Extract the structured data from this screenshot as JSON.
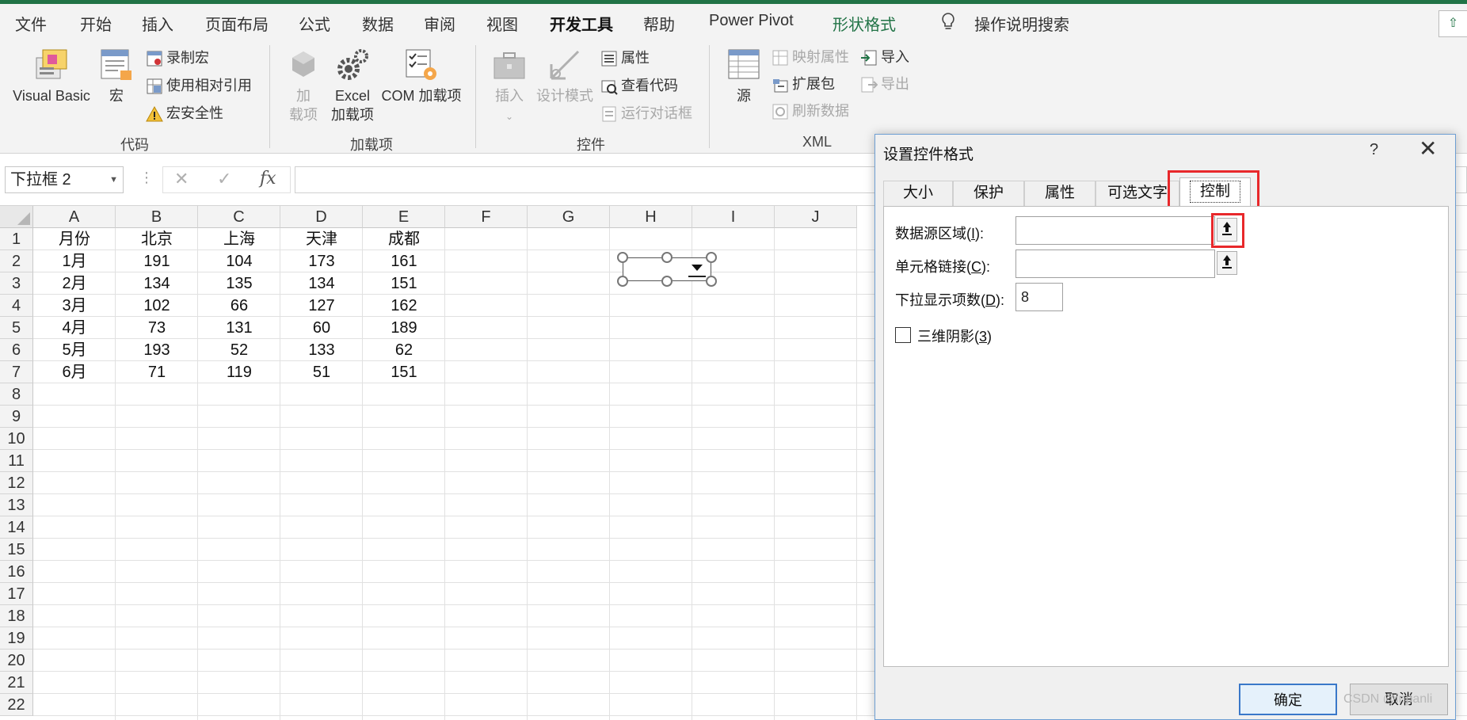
{
  "ribbon_tabs": [
    "文件",
    "开始",
    "插入",
    "页面布局",
    "公式",
    "数据",
    "审阅",
    "视图",
    "开发工具",
    "帮助",
    "Power Pivot",
    "形状格式"
  ],
  "active_tab": "开发工具",
  "search_label": "操作说明搜索",
  "groups": {
    "code": {
      "label": "代码",
      "visual_basic": "Visual Basic",
      "macros": "宏",
      "record_macro": "录制宏",
      "relative_ref": "使用相对引用",
      "macro_security": "宏安全性"
    },
    "addins": {
      "label": "加载项",
      "addins_l1": "加",
      "addins_l2": "载项",
      "excel_addins_l1": "Excel",
      "excel_addins_l2": "加载项",
      "com_addins": "COM 加载项"
    },
    "controls": {
      "label": "控件",
      "insert": "插入",
      "design_mode": "设计模式",
      "properties": "属性",
      "view_code": "查看代码",
      "run_dialog": "运行对话框"
    },
    "xml": {
      "label": "XML",
      "source": "源",
      "map_properties": "映射属性",
      "expansion_packs": "扩展包",
      "refresh_data": "刷新数据",
      "import": "导入",
      "export": "导出"
    }
  },
  "name_box": "下拉框 2",
  "formula_icons": {
    "cancel": "✕",
    "enter": "✓",
    "fx": "fx"
  },
  "columns": [
    "A",
    "B",
    "C",
    "D",
    "E",
    "F",
    "G",
    "H",
    "I",
    "J"
  ],
  "rows": [
    "1",
    "2",
    "3",
    "4",
    "5",
    "6",
    "7",
    "8",
    "9",
    "10",
    "11",
    "12",
    "13",
    "14",
    "15",
    "16",
    "17",
    "18",
    "19",
    "20",
    "21",
    "22"
  ],
  "table": {
    "header": [
      "月份",
      "北京",
      "上海",
      "天津",
      "成都"
    ],
    "rows": [
      [
        "1月",
        "191",
        "104",
        "173",
        "161"
      ],
      [
        "2月",
        "134",
        "135",
        "134",
        "151"
      ],
      [
        "3月",
        "102",
        "66",
        "127",
        "162"
      ],
      [
        "4月",
        "73",
        "131",
        "60",
        "189"
      ],
      [
        "5月",
        "193",
        "52",
        "133",
        "62"
      ],
      [
        "6月",
        "71",
        "119",
        "51",
        "151"
      ]
    ]
  },
  "dialog": {
    "title": "设置控件格式",
    "help": "?",
    "close": "✕",
    "tabs": [
      "大小",
      "保护",
      "属性",
      "可选文字",
      "控制"
    ],
    "active_tab": "控制",
    "fields": {
      "input_range": {
        "label": "数据源区域(",
        "key": "I",
        "suffix": "):",
        "value": ""
      },
      "cell_link": {
        "label": "单元格链接(",
        "key": "C",
        "suffix": "):",
        "value": ""
      },
      "dropdown_lines": {
        "label": "下拉显示项数(",
        "key": "D",
        "suffix": "):",
        "value": "8"
      }
    },
    "shading": {
      "label": "三维阴影(",
      "key": "3",
      "suffix": ")",
      "checked": false
    },
    "ok": "确定",
    "cancel": "取消"
  },
  "watermark": "CSDN @inpanli",
  "colors": {
    "excel_green": "#217346",
    "highlight_red": "#e8282b"
  }
}
